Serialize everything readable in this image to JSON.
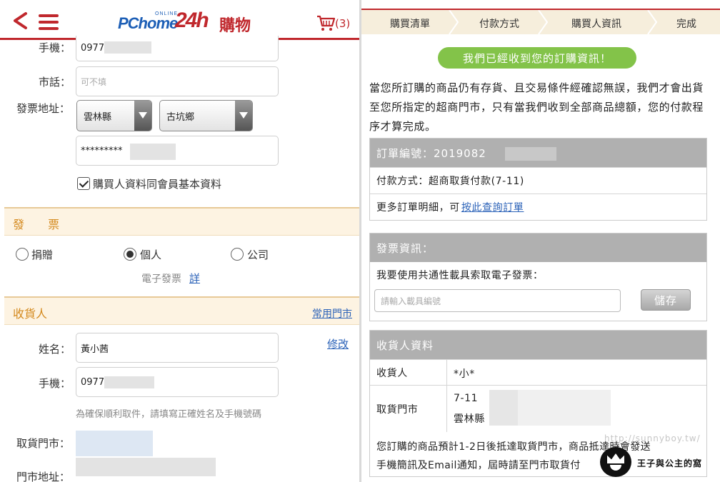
{
  "left": {
    "header": {
      "cart_count": "(3)",
      "logo_pc": "PChome",
      "logo_online": "ONLINE",
      "logo_24h": "24h",
      "logo_shop": "購物"
    },
    "buyer": {
      "mobile_label": "手機：",
      "mobile_value": "0977",
      "phone_label": "市話：",
      "phone_placeholder": "可不填",
      "address_label": "發票地址：",
      "county": "雲林縣",
      "district": "古坑鄉",
      "address_value": "*********",
      "same_as_member": "購買人資料同會員基本資料"
    },
    "invoice": {
      "title": "發 票",
      "options": [
        "捐贈",
        "個人",
        "公司"
      ],
      "selected": "個人",
      "einvoice_label": "電子發票",
      "einvoice_link": "詳"
    },
    "receiver": {
      "title": "收貨人",
      "common_store_link": "常用門市",
      "name_label": "姓名：",
      "name_value": "黃小茜",
      "edit_link": "修改",
      "mobile_label": "手機：",
      "mobile_value": "0977",
      "hint": "為確保順利取件，請填寫正確姓名及手機號碼",
      "store_label": "取貨門市：",
      "store_address_label": "門市地址："
    }
  },
  "right": {
    "steps": [
      "購買清單",
      "付款方式",
      "購買人資訊",
      "完成"
    ],
    "banner": "我們已經收到您的訂購資訊！",
    "message": "當您所訂購的商品仍有存貨、且交易條件經確認無誤，我們才會出貨至您所指定的超商門市，只有當我們收到全部商品總額，您的付款程序才算完成。",
    "order": {
      "number_label": "訂單編號：2019082",
      "payment": "付款方式：超商取貨付款(7-11)",
      "detail_prefix": "更多訂單明細，可",
      "detail_link": "按此查詢訂單"
    },
    "invoice_info": {
      "title": "發票資訊：",
      "carrier_prompt": "我要使用共通性載具索取電子發票：",
      "carrier_placeholder": "請輸入載具編號",
      "save_button": "儲存"
    },
    "receiver_info": {
      "title": "收貨人資料",
      "receiver_label": "收貨人",
      "receiver_value": "*小*",
      "store_label": "取貨門市",
      "store_line1": "7-11",
      "store_line2": "雲林縣",
      "notice_line1": "您訂購的商品預計1-2日後抵達取貨門市，商品抵達時會發送",
      "notice_line2": "手機簡訊及Email通知，屆時請至門市取貨付"
    },
    "watermark": "http://sunnyboy.tw/",
    "badge_text": "王子與公主的窩"
  },
  "colors": {
    "brand_red": "#c0282d",
    "section_orange": "#d4891d",
    "banner_green": "#83c349",
    "link_blue": "#2b62b8",
    "header_gray": "#b0b0b0"
  }
}
